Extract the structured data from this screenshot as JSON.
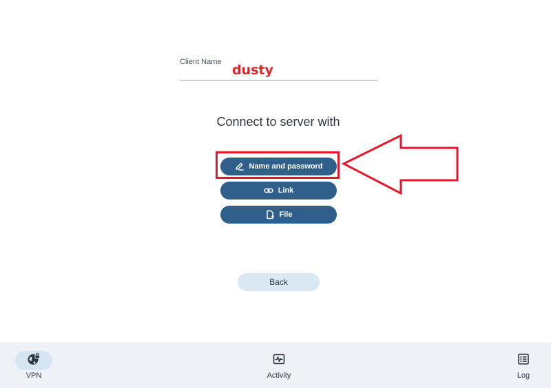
{
  "client": {
    "label": "Client Name",
    "value": "dusty"
  },
  "connect": {
    "heading": "Connect to server with",
    "options": [
      {
        "label": "Name and password",
        "icon": "edit-pen-icon"
      },
      {
        "label": "Link",
        "icon": "link-icon"
      },
      {
        "label": "File",
        "icon": "file-add-icon"
      }
    ]
  },
  "back_label": "Back",
  "annotation": {
    "color": "#e4182a",
    "shape": "arrow-pointing-left",
    "target": "Name and password"
  },
  "bottom_nav": {
    "items": [
      {
        "label": "VPN",
        "icon": "globe-lock-icon",
        "active": true
      },
      {
        "label": "Activity",
        "icon": "activity-icon",
        "active": false
      },
      {
        "label": "Log",
        "icon": "log-list-icon",
        "active": false
      }
    ]
  },
  "colors": {
    "primary_button": "#2f5f8a",
    "secondary_button": "#d9e8f3",
    "nav_background": "#eef2f7",
    "client_name_text": "#e0222a"
  }
}
